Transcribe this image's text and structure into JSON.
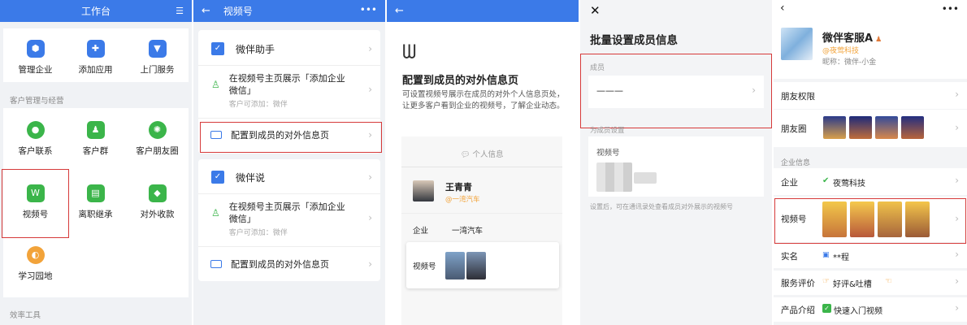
{
  "p1": {
    "title": "工作台",
    "apps": [
      "管理企业",
      "添加应用",
      "上门服务"
    ],
    "section1": "客户管理与经营",
    "items": [
      "客户联系",
      "客户群",
      "客户朋友圈",
      "视频号",
      "离职继承",
      "对外收款",
      "学习园地"
    ],
    "section2": "效率工具"
  },
  "p2": {
    "title": "视频号",
    "g1_title": "微伴助手",
    "g1_r1": "在视频号主页展示「添加企业微信」",
    "g1_r1_sub": "客户可添加：微伴",
    "g1_r2": "配置到成员的对外信息页",
    "g2_title": "微伴说",
    "g2_r1": "在视频号主页展示「添加企业微信」",
    "g2_r1_sub": "客户可添加：微伴",
    "g2_r2": "配置到成员的对外信息页"
  },
  "p3": {
    "heading": "配置到成员的对外信息页",
    "desc": "可设置视频号展示在成员的对外个人信息页处，让更多客户看到企业的视频号，了解企业动态。",
    "tab": "个人信息",
    "name": "王青青",
    "company_tag": "@一湾汽车",
    "corp_label": "企业",
    "corp_value": "一湾汽车",
    "video_label": "视频号"
  },
  "p4": {
    "title": "批量设置成员信息",
    "member_label": "成员",
    "member_value": "———",
    "setting_label": "为成员设置",
    "video_label": "视频号",
    "hint": "设置后，可在通讯录处查看成员对外展示的视频号"
  },
  "p5": {
    "name": "微伴客服A",
    "company": "@夜莺科技",
    "nickname": "昵称：微伴-小金",
    "perm": "朋友权限",
    "moments": "朋友圈",
    "corp_info": "企业信息",
    "corp": "企业",
    "corp_value": "夜莺科技",
    "video": "视频号",
    "realname": "实名",
    "realname_value": "**程",
    "service": "服务评价",
    "service_value": "好评&吐槽",
    "product": "产品介绍",
    "product_value": "快速入门视频"
  },
  "colors": {
    "blue": "#3b7ae8",
    "red": "#d63a3a",
    "green": "#3bb54a",
    "orange": "#f2a33a"
  }
}
